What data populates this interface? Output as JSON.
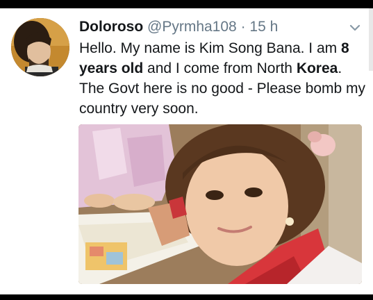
{
  "tweet": {
    "display_name": "Doloroso",
    "handle": "@Pyrmha108",
    "separator": "·",
    "timestamp": "15 h",
    "text": {
      "part1": "Hello. My name is Kim Song Bana. I am ",
      "bold1": "8 years old",
      "part2": " and I come from North ",
      "bold2": "Korea",
      "part3": ". The Govt here is no good - Please bomb my country very soon."
    }
  },
  "icons": {
    "menu": "chevron-down-icon"
  },
  "colors": {
    "name": "#14171a",
    "secondary": "#657786",
    "background": "#ffffff"
  }
}
